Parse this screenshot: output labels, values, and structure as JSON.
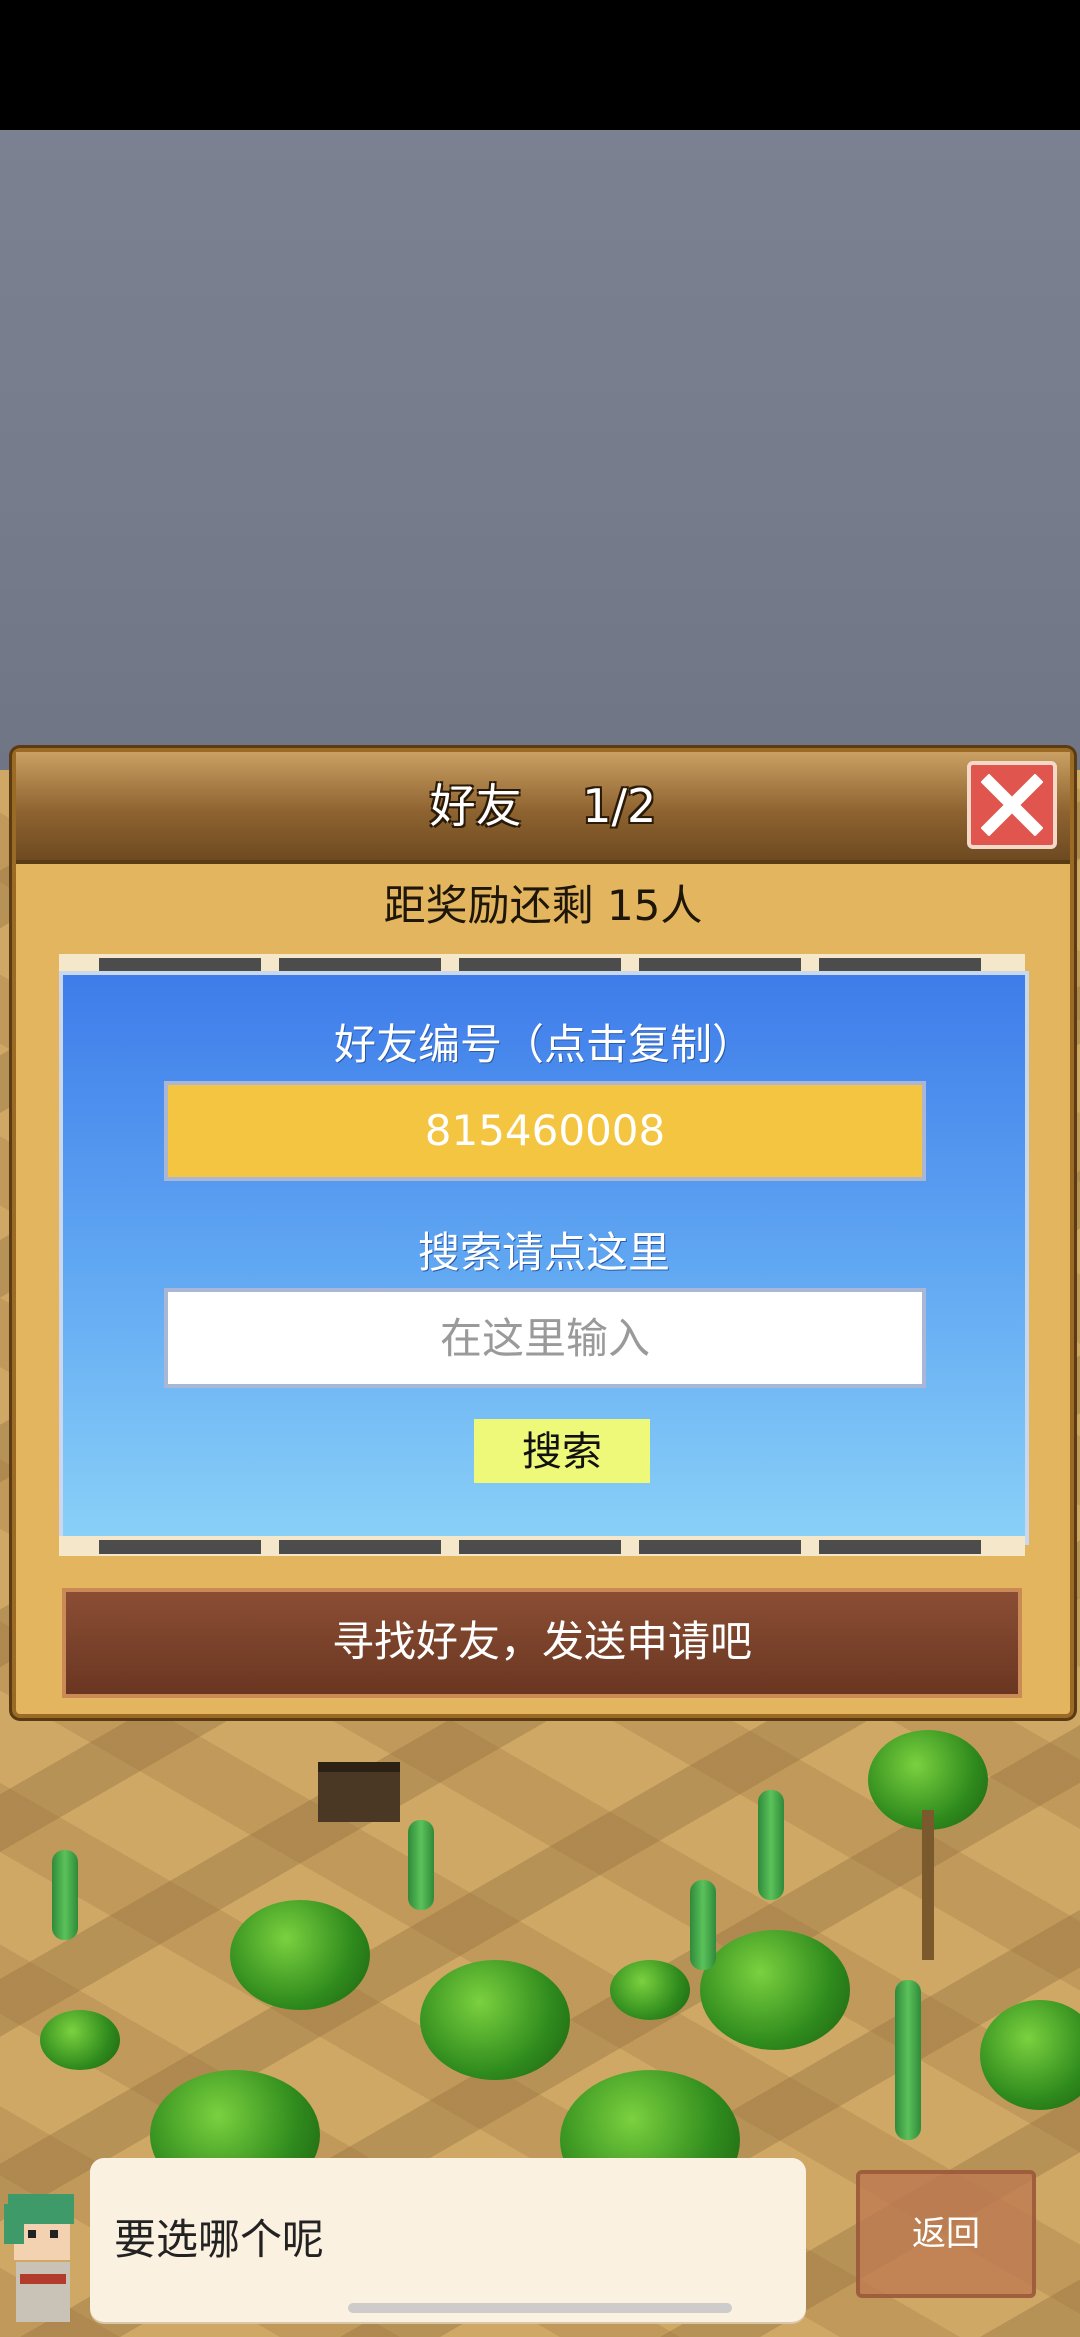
{
  "dialog": {
    "title": "好友　 1/2",
    "reward_text": "距奖励还剩 15人",
    "friend_id_label": "好友编号（点击复制）",
    "friend_id": "815460008",
    "search_label": "搜索请点这里",
    "search_placeholder": "在这里输入",
    "search_button": "搜索",
    "find_friends_button": "寻找好友，发送申请吧"
  },
  "footer": {
    "speech_text": "要选哪个呢",
    "back_button": "返回"
  },
  "colors": {
    "panel_blue": "#3e7cea",
    "id_box_yellow": "#f4c540",
    "close_red": "#e0564e",
    "search_button_yellow": "#eef97a"
  },
  "icons": [
    "close-icon",
    "left-arrow-icon",
    "right-arrow-icon"
  ]
}
